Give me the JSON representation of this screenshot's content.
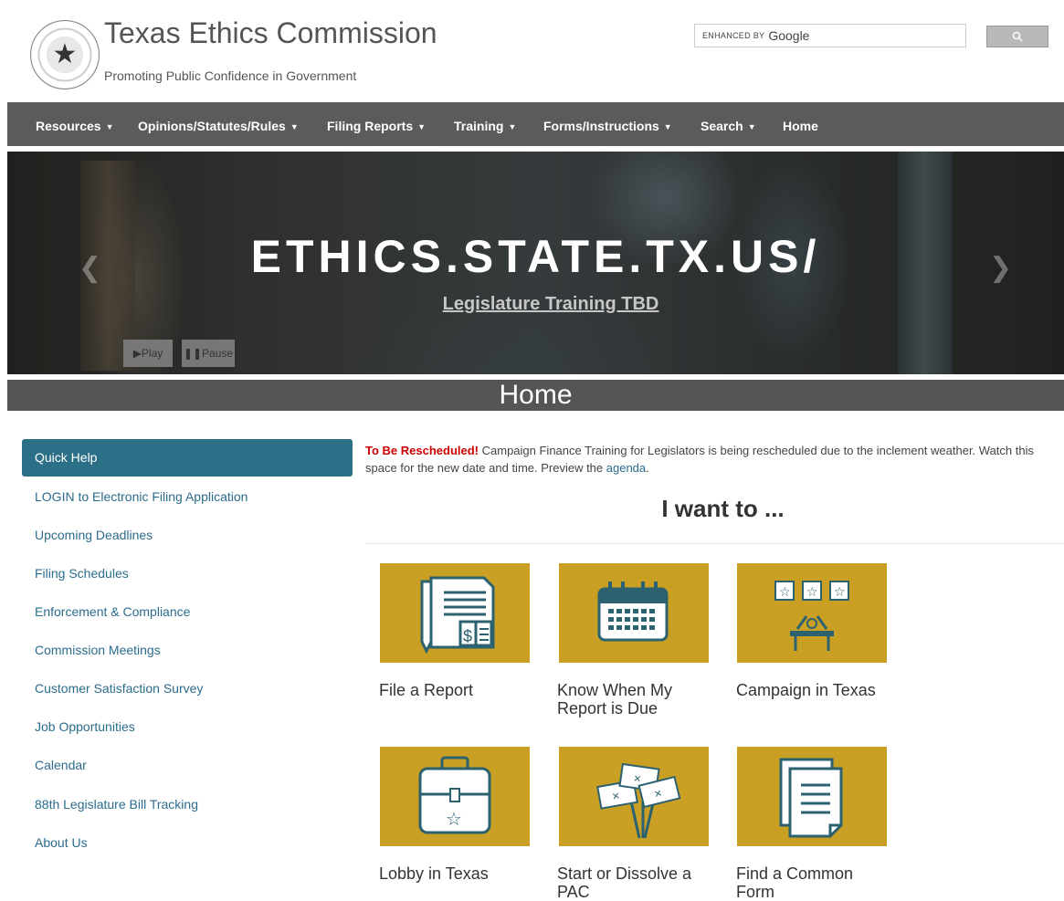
{
  "header": {
    "seal_icon": "texas-seal",
    "title": "Texas Ethics Commission",
    "tagline": "Promoting Public Confidence in Government",
    "search": {
      "enhanced_label": "ENHANCED BY",
      "brand": "Google",
      "button_icon": "search-icon"
    }
  },
  "nav": [
    {
      "label": "Resources",
      "dropdown": true
    },
    {
      "label": "Opinions/Statutes/Rules",
      "dropdown": true
    },
    {
      "label": "Filing Reports",
      "dropdown": true
    },
    {
      "label": "Training",
      "dropdown": true
    },
    {
      "label": "Forms/Instructions",
      "dropdown": true
    },
    {
      "label": "Search",
      "dropdown": true
    },
    {
      "label": "Home",
      "dropdown": false
    }
  ],
  "hero": {
    "overlay_text": "ETHICS.STATE.TX.US/",
    "caption": "Legislature Training TBD",
    "play_label": "▶Play",
    "pause_label": "❚❚Pause"
  },
  "page_title": "Home",
  "sidebar": {
    "heading": "Quick Help",
    "items": [
      "LOGIN to Electronic Filing Application",
      "Upcoming Deadlines",
      "Filing Schedules",
      "Enforcement & Compliance",
      "Commission Meetings",
      "Customer Satisfaction Survey",
      "Job Opportunities",
      "Calendar",
      "88th Legislature Bill Tracking",
      "About Us"
    ]
  },
  "notice": {
    "alert": "To Be Rescheduled!",
    "text": " Campaign Finance Training for Legislators is being rescheduled due to the inclement weather. Watch this space for the new date and time. Preview the ",
    "link": "agenda",
    "end": "."
  },
  "i_want_heading": "I want to ...",
  "tiles": [
    {
      "label": "File a Report",
      "icon": "report-document-icon"
    },
    {
      "label": "Know When My Report is Due",
      "icon": "calendar-icon"
    },
    {
      "label": "Campaign in Texas",
      "icon": "podium-banner-icon"
    },
    {
      "label": "Lobby in Texas",
      "icon": "briefcase-icon"
    },
    {
      "label": "Start or Dissolve a PAC",
      "icon": "picket-signs-icon"
    },
    {
      "label": "Find a Common Form",
      "icon": "forms-icon"
    }
  ],
  "colors": {
    "nav_bg": "#5b5b5b",
    "quick_help_bg": "#2b7086",
    "tile_bg": "#c9a023",
    "link": "#2b6c8c",
    "alert": "#cc0000"
  }
}
